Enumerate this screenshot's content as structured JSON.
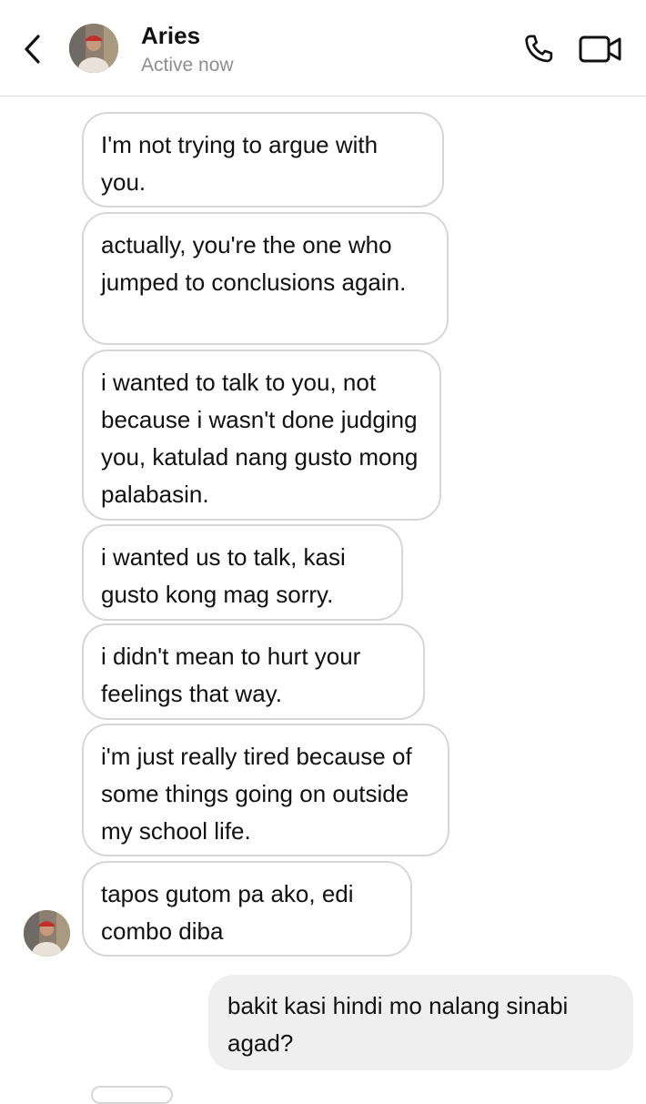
{
  "header": {
    "contact_name": "Aries",
    "status": "Active now",
    "back_icon": "chevron-left-icon",
    "call_icon": "phone-icon",
    "video_icon": "video-camera-icon"
  },
  "messages": [
    {
      "direction": "received",
      "text": "I'm not trying to argue with you."
    },
    {
      "direction": "received",
      "text": "actually, you're the one who jumped to conclusions again."
    },
    {
      "direction": "received",
      "text": "i wanted to talk to you, not because i wasn't done judging you, katulad nang gusto mong palabasin."
    },
    {
      "direction": "received",
      "text": "i wanted us to talk, kasi gusto kong mag sorry."
    },
    {
      "direction": "received",
      "text": "i didn't mean to hurt your feelings that way."
    },
    {
      "direction": "received",
      "text": "i'm just really tired because of some things going on outside my school life."
    },
    {
      "direction": "received",
      "text": "tapos gutom pa ako, edi combo diba"
    },
    {
      "direction": "sent",
      "text": "bakit kasi hindi mo nalang sinabi agad?"
    }
  ],
  "colors": {
    "received_border": "#d6d6d6",
    "sent_background": "#efefef",
    "secondary_text": "#8e8e8e"
  }
}
